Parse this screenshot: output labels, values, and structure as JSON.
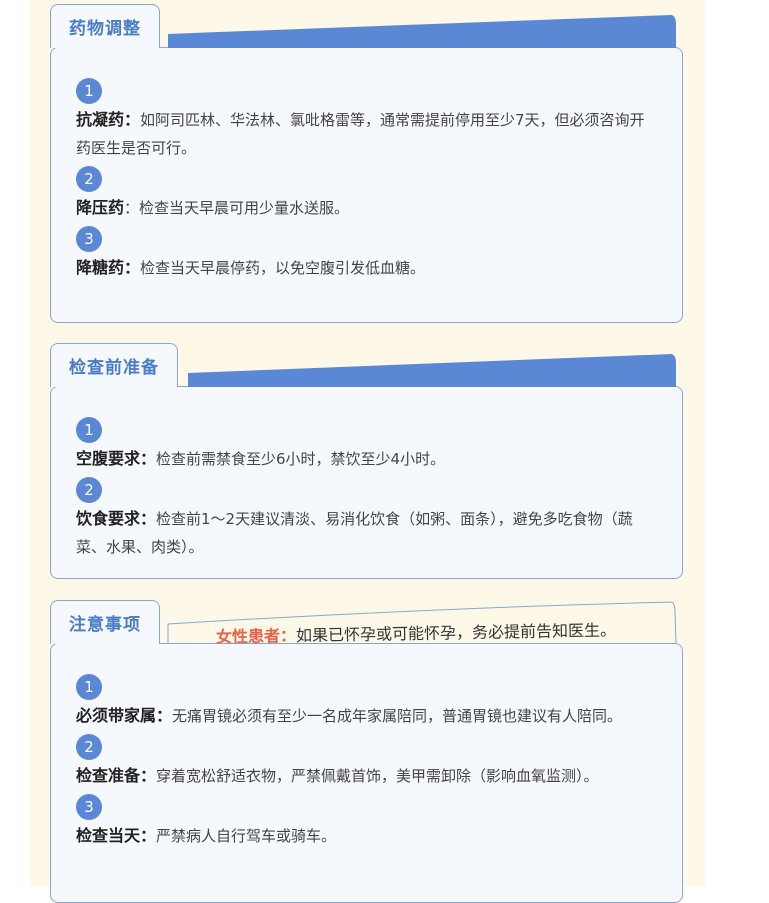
{
  "colors": {
    "accent": "#5b88d4",
    "warning": "#e8624a",
    "background": "#fdf8e8"
  },
  "sections": [
    {
      "title": "药物调整",
      "items": [
        {
          "num": "1",
          "label": "抗凝药：",
          "text": "如阿司匹林、华法林、氯吡格雷等，通常需提前停用至少7天，但必须咨询开药医生是否可行。"
        },
        {
          "num": "2",
          "label": "降压药",
          "text": "：检查当天早晨可用少量水送服。"
        },
        {
          "num": "3",
          "label": "降糖药：",
          "text": "检查当天早晨停药，以免空腹引发低血糖。"
        }
      ]
    },
    {
      "title": "检查前准备",
      "items": [
        {
          "num": "1",
          "label": "空腹要求：",
          "text": "检查前需禁食至少6小时，禁饮至少4小时。"
        },
        {
          "num": "2",
          "label": " 饮食要求：",
          "text": "检查前1～2天建议清淡、易消化饮食（如粥、面条），避免多吃食物（蔬菜、水果、肉类）。"
        }
      ]
    },
    {
      "title": "注意事项",
      "notice_label": "女性患者：",
      "notice_text": "如果已怀孕或可能怀孕，务必提前告知医生。",
      "items": [
        {
          "num": "1",
          "label": "必须带家属：",
          "text": "无痛胃镜必须有至少一名成年家属陪同，普通胃镜也建议有人陪同。"
        },
        {
          "num": "2",
          "label": "检查准备：",
          "text": "穿着宽松舒适衣物，严禁佩戴首饰，美甲需卸除（影响血氧监测）。"
        },
        {
          "num": "3",
          "label": "检查当天：",
          "text": "严禁病人自行驾车或骑车。"
        }
      ]
    }
  ]
}
